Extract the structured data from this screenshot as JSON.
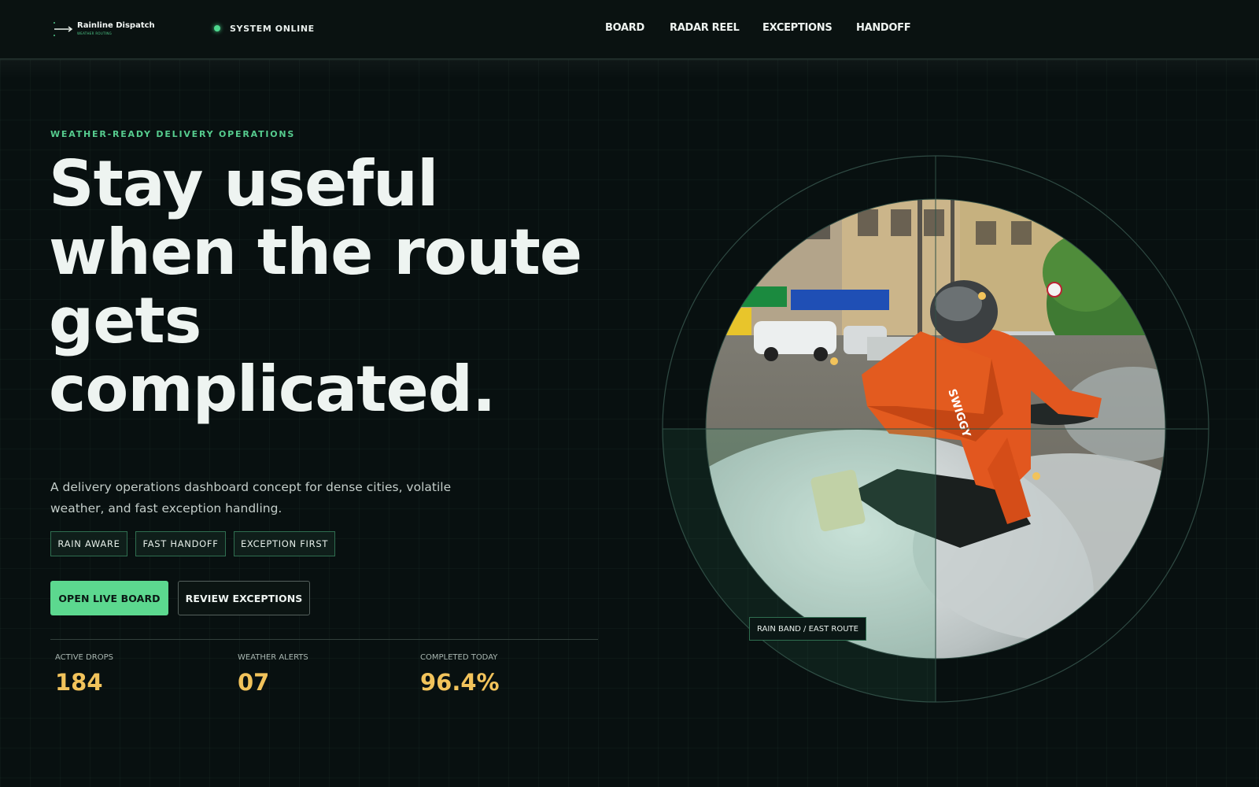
{
  "brand": {
    "name": "Rainline Dispatch",
    "tagline": "WEATHER ROUTING"
  },
  "status": {
    "label": "SYSTEM ONLINE"
  },
  "nav": {
    "items": [
      {
        "label": "BOARD"
      },
      {
        "label": "RADAR REEL"
      },
      {
        "label": "EXCEPTIONS"
      },
      {
        "label": "HANDOFF"
      }
    ]
  },
  "hero": {
    "eyebrow": "WEATHER-READY DELIVERY OPERATIONS",
    "headline_lines": [
      "Stay useful",
      "when the route",
      "gets",
      "complicated."
    ],
    "description": "A delivery operations dashboard concept for dense cities, volatile weather, and fast exception handling.",
    "tags": [
      "RAIN AWARE",
      "FAST HANDOFF",
      "EXCEPTION FIRST"
    ],
    "primary_cta": "OPEN LIVE BOARD",
    "secondary_cta": "REVIEW EXCEPTIONS"
  },
  "stats": [
    {
      "label": "ACTIVE DROPS",
      "value": "184"
    },
    {
      "label": "WEATHER ALERTS",
      "value": "07"
    },
    {
      "label": "COMPLETED TODAY",
      "value": "96.4%"
    }
  ],
  "radar": {
    "photo_label": "RAIN BAND / EAST ROUTE",
    "bag_brand": "SWIGGY"
  },
  "colors": {
    "background": "#081010",
    "accent_green": "#5cd88f",
    "stat_gold": "#f2c35b",
    "rider_orange": "#e2571f"
  }
}
